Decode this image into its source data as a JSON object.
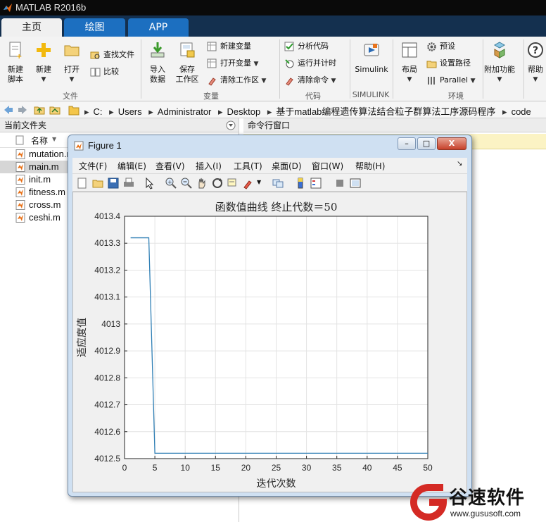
{
  "app": {
    "title": "MATLAB R2016b"
  },
  "tabs": [
    {
      "label": "主页"
    },
    {
      "label": "绘图"
    },
    {
      "label": "APP"
    }
  ],
  "ribbon": {
    "new_script": "新建\n脚本",
    "new": "新建",
    "open": "打开",
    "find_files": "查找文件",
    "compare": "比较",
    "group_file": "文件",
    "import_data": "导入\n数据",
    "save_workspace": "保存\n工作区",
    "new_variable": "新建变量",
    "open_variable": "打开变量",
    "clear_workspace": "清除工作区",
    "group_variable": "变量",
    "analyze_code": "分析代码",
    "run_time": "运行并计时",
    "clear_commands": "清除命令",
    "group_code": "代码",
    "simulink": "Simulink",
    "group_simulink": "SIMULINK",
    "layout": "布局",
    "preferences": "预设",
    "set_path": "设置路径",
    "parallel": "Parallel",
    "group_env": "环境",
    "addons": "附加功能",
    "help": "帮助"
  },
  "address": {
    "crumbs": [
      "C:",
      "Users",
      "Administrator",
      "Desktop",
      "基于matlab编程遗传算法结合粒子群算法工序源码程序",
      "code"
    ]
  },
  "file_panel": {
    "title": "当前文件夹",
    "name_header": "名称",
    "sort_indicator": "▼",
    "files": [
      {
        "name": "mutation.m",
        "selected": false
      },
      {
        "name": "main.m",
        "selected": true
      },
      {
        "name": "init.m",
        "selected": false
      },
      {
        "name": "fitness.m",
        "selected": false
      },
      {
        "name": "cross.m",
        "selected": false
      },
      {
        "name": "ceshi.m",
        "selected": false
      }
    ]
  },
  "command_panel": {
    "title": "命令行窗口"
  },
  "figure": {
    "title": "Figure 1",
    "menu": [
      "文件(F)",
      "编辑(E)",
      "查看(V)",
      "插入(I)",
      "工具(T)",
      "桌面(D)",
      "窗口(W)",
      "帮助(H)"
    ],
    "minimize": "–",
    "restore": "□",
    "close": "X"
  },
  "chart_data": {
    "type": "line",
    "title": "函数值曲线  终止代数＝50",
    "xlabel": "迭代次数",
    "ylabel": "适应度值",
    "xlim": [
      0,
      50
    ],
    "ylim": [
      4012.5,
      4013.4
    ],
    "xticks": [
      0,
      5,
      10,
      15,
      20,
      25,
      30,
      35,
      40,
      45,
      50
    ],
    "yticks": [
      4012.5,
      4012.6,
      4012.7,
      4012.8,
      4012.9,
      4013,
      4013.1,
      4013.2,
      4013.3,
      4013.4
    ],
    "grid": true,
    "line_color": "#2f7fb5",
    "series": [
      {
        "x": [
          1,
          2,
          3,
          4,
          5,
          6,
          7,
          8,
          9,
          10,
          15,
          20,
          25,
          30,
          35,
          40,
          45,
          50
        ],
        "values": [
          4013.32,
          4013.32,
          4013.32,
          4013.32,
          4012.52,
          4012.52,
          4012.52,
          4012.52,
          4012.52,
          4012.52,
          4012.52,
          4012.52,
          4012.52,
          4012.52,
          4012.52,
          4012.52,
          4012.52,
          4012.52
        ]
      }
    ]
  },
  "watermark": {
    "text": "谷速软件",
    "url": "www.gususoft.com"
  },
  "colors": {
    "accent": "#1c6fc0",
    "tabstrip": "#14304f",
    "line": "#2f7fb5"
  }
}
